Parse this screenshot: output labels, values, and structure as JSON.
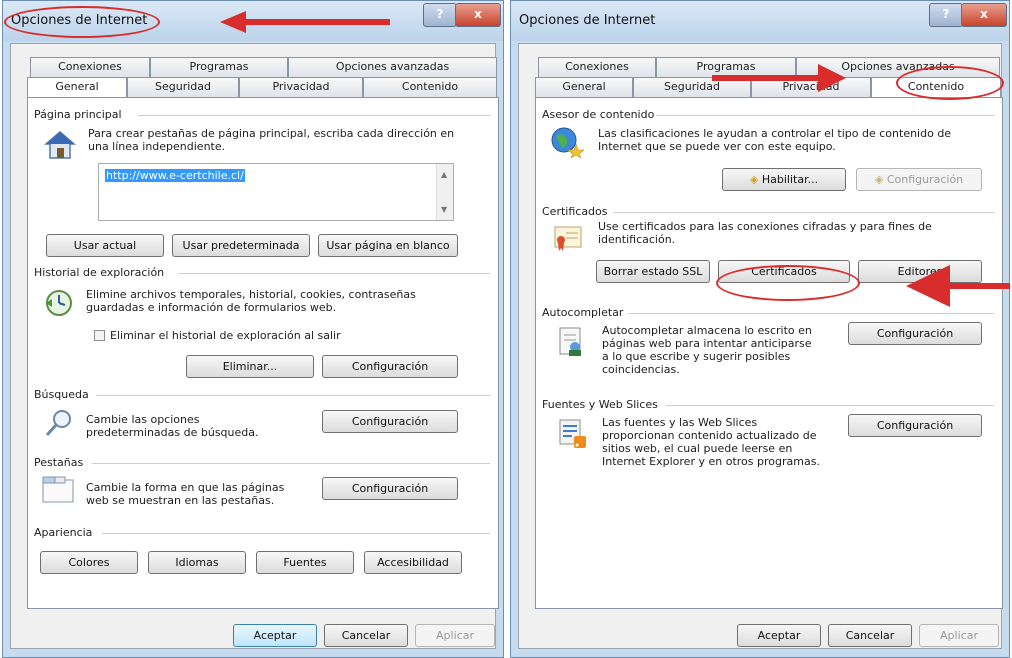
{
  "left_dialog": {
    "title": "Opciones de Internet",
    "tabs_row1": [
      "Conexiones",
      "Programas",
      "Opciones avanzadas"
    ],
    "tabs_row2": [
      "General",
      "Seguridad",
      "Privacidad",
      "Contenido"
    ],
    "active_tab": "General",
    "home_page": {
      "label": "Página principal",
      "description": "Para crear pestañas de página principal, escriba cada dirección en una línea independiente.",
      "url": "http://www.e-certchile.cl/",
      "buttons": [
        "Usar actual",
        "Usar predeterminada",
        "Usar página en blanco"
      ]
    },
    "history": {
      "label": "Historial de exploración",
      "description": "Elimine archivos temporales, historial, cookies, contraseñas guardadas e información de formularios web.",
      "checkbox": "Eliminar el historial de exploración al salir",
      "delete_button": "Eliminar...",
      "settings_button": "Configuración"
    },
    "search": {
      "label": "Búsqueda",
      "description": "Cambie las opciones predeterminadas de búsqueda.",
      "settings_button": "Configuración"
    },
    "tabs_group": {
      "label": "Pestañas",
      "description": "Cambie la forma en que las páginas web se muestran en las pestañas.",
      "settings_button": "Configuración"
    },
    "appearance": {
      "label": "Apariencia",
      "buttons": [
        "Colores",
        "Idiomas",
        "Fuentes",
        "Accesibilidad"
      ]
    },
    "footer": [
      "Aceptar",
      "Cancelar",
      "Aplicar"
    ],
    "title_close": "x",
    "title_help": "?"
  },
  "right_dialog": {
    "title": "Opciones de Internet",
    "tabs_row1": [
      "Conexiones",
      "Programas",
      "Opciones avanzadas"
    ],
    "tabs_row2": [
      "General",
      "Seguridad",
      "Privacidad",
      "Contenido"
    ],
    "active_tab": "Contenido",
    "content_advisor": {
      "label": "Asesor de contenido",
      "description": "Las clasificaciones le ayudan a controlar el tipo de contenido de Internet que se puede ver con este equipo.",
      "enable_button": "Habilitar...",
      "settings_button": "Configuración"
    },
    "certificates": {
      "label": "Certificados",
      "description": "Use certificados para las conexiones cifradas y para fines de identificación.",
      "buttons": [
        "Borrar estado SSL",
        "Certificados",
        "Editores"
      ]
    },
    "autocomplete": {
      "label": "Autocompletar",
      "description": "Autocompletar almacena lo escrito en páginas web para intentar anticiparse a lo que escribe y sugerir posibles coincidencias.",
      "settings_button": "Configuración"
    },
    "feeds": {
      "label": "Fuentes y Web Slices",
      "description": "Las fuentes y las Web Slices proporcionan contenido actualizado de sitios web, el cual puede leerse en Internet Explorer y en otros programas.",
      "settings_button": "Configuración"
    },
    "footer": [
      "Aceptar",
      "Cancelar",
      "Aplicar"
    ],
    "title_close": "x",
    "title_help": "?"
  },
  "colors": {
    "annotation_red": "#d92c2c",
    "titlebar": "#c6dbee",
    "selection": "#3399ff"
  }
}
